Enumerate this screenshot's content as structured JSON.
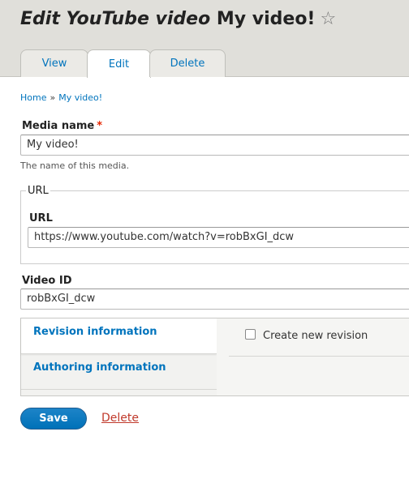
{
  "page": {
    "title_prefix": "Edit YouTube video",
    "title_name": "My video!",
    "star_icon": "star-icon"
  },
  "tabs": [
    {
      "label": "View",
      "active": false
    },
    {
      "label": "Edit",
      "active": true
    },
    {
      "label": "Delete",
      "active": false
    }
  ],
  "breadcrumb": {
    "home": "Home",
    "separator": "»",
    "current": "My video!"
  },
  "media_name": {
    "label": "Media name",
    "required_marker": "*",
    "value": "My video!",
    "description": "The name of this media."
  },
  "url_fieldset": {
    "legend": "URL",
    "label": "URL",
    "value": "https://www.youtube.com/watch?v=robBxGI_dcw"
  },
  "video_id": {
    "label": "Video ID",
    "value": "robBxGI_dcw"
  },
  "vertical_tabs": {
    "items": [
      {
        "label": "Revision information",
        "active": true
      },
      {
        "label": "Authoring information",
        "active": false
      }
    ],
    "create_revision_label": "Create new revision",
    "create_revision_checked": false
  },
  "actions": {
    "save_label": "Save",
    "delete_label": "Delete"
  },
  "colors": {
    "link": "#0074bd",
    "primary_button": "#0071b8",
    "danger_link": "#c0392b",
    "required": "#e62600",
    "header_bg": "#e0dfda"
  }
}
